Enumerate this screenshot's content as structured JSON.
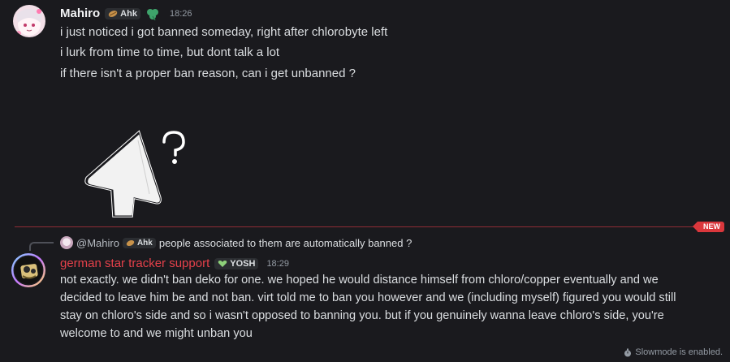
{
  "message1": {
    "author": "Mahiro",
    "tag": "Ahk",
    "time": "18:26",
    "name_color": "#f2f3f5",
    "lines": [
      "i just noticed i got banned someday, right after chlorobyte left",
      "i lurk from time to time, but dont talk a lot",
      "if there isn't a proper ban reason, can i get unbanned ?"
    ],
    "sticker": "question-cone-sticker"
  },
  "divider": {
    "badge": "NEW",
    "color": "#da373c"
  },
  "message2": {
    "reply": {
      "author": "@Mahiro",
      "tag": "Ahk",
      "text": "people associated to them are automatically banned ?"
    },
    "author": "german star tracker support",
    "tag": "YOSH",
    "time": "18:29",
    "name_color": "#e5414a",
    "lines": [
      "not exactly. we didn't ban deko for one. we hoped he would distance himself from chloro/copper eventually and we",
      "decided to leave him be and not ban. virt told me to ban you however and we (including myself) figured you would still",
      "stay on chloro's side and so i wasn't opposed to banning you. but if you genuinely wanna leave chloro's side, you're",
      "welcome to and we might unban you"
    ]
  },
  "footer": {
    "slowmode": "Slowmode is enabled."
  }
}
